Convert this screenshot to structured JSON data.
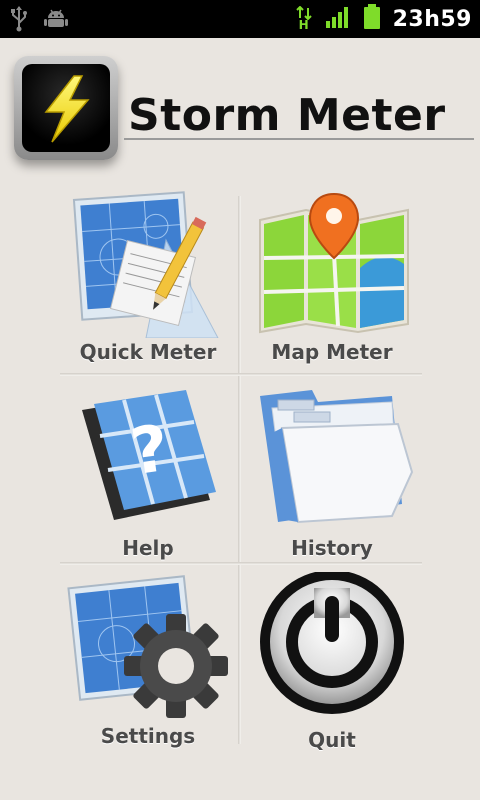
{
  "status_bar": {
    "time": "23h59",
    "icons": [
      "usb-icon",
      "android-debug-icon",
      "hspa-data-icon",
      "signal-icon",
      "battery-icon"
    ],
    "network_type": "H"
  },
  "header": {
    "app_name": "Storm Meter",
    "logo_icon": "lightning-bolt-icon"
  },
  "menu": {
    "items": [
      {
        "label": "Quick Meter",
        "icon": "blueprint-pencil-icon"
      },
      {
        "label": "Map Meter",
        "icon": "map-pin-icon"
      },
      {
        "label": "Help",
        "icon": "question-mark-icon"
      },
      {
        "label": "History",
        "icon": "folder-icon"
      },
      {
        "label": "Settings",
        "icon": "blueprint-gear-icon"
      },
      {
        "label": "Quit",
        "icon": "power-icon"
      }
    ]
  },
  "colors": {
    "background": "#e9e5e0",
    "status_bar": "#000000",
    "label_text": "#4a4a4a",
    "accent_green": "#8cd63a",
    "bolt_yellow": "#f3e51a"
  }
}
